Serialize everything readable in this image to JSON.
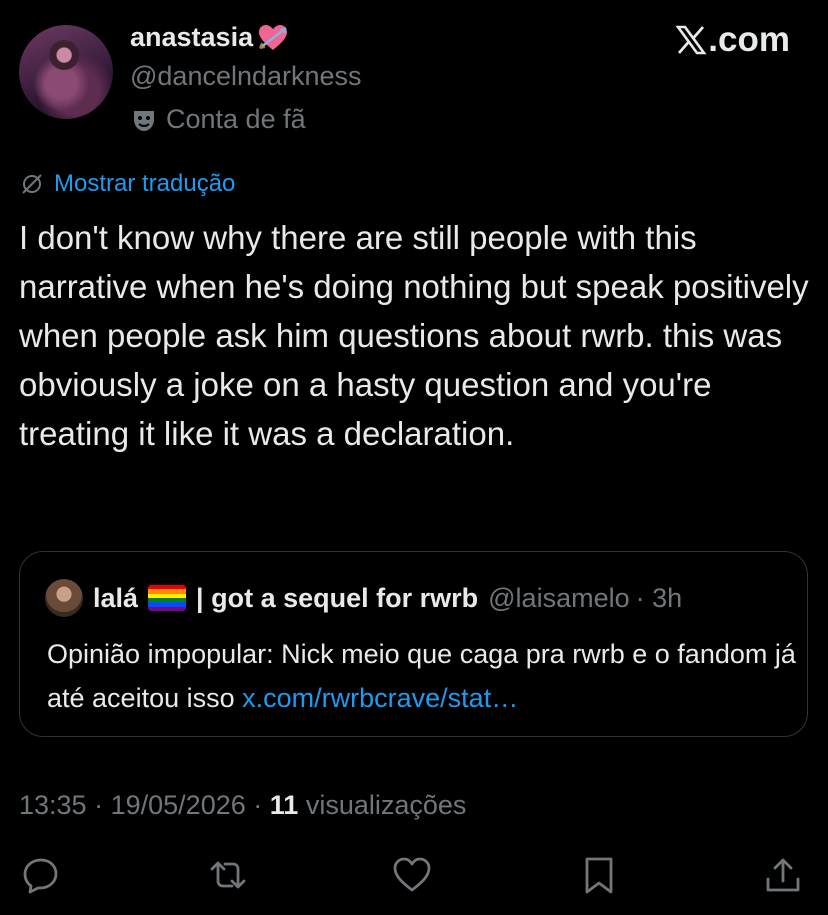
{
  "author": {
    "display_name": "anastasia",
    "name_emoji": "heart-with-arrow-icon",
    "handle": "@dancelndarkness",
    "label": "Conta de fã",
    "label_icon": "theater-mask-icon"
  },
  "brand": {
    "logo_text": ".com",
    "logo_icon": "x-logo-icon"
  },
  "translate": {
    "label": "Mostrar tradução",
    "icon": "globe-slash-icon"
  },
  "tweet": {
    "text": "I don't know why there are still people with this narrative when he's doing nothing but speak positively when people ask him questions about rwrb. this was obviously a joke on a hasty question and you're treating it like it was a declaration."
  },
  "quote": {
    "name": "lalá",
    "name_suffix": "| got a sequel for rwrb",
    "handle": "@laisamelo",
    "time": "· 3h",
    "text": "Opinião impopular: Nick meio que caga pra rwrb e o fandom já até aceitou isso",
    "link": "x.com/rwrbcrave/stat…"
  },
  "meta": {
    "time": "13:35",
    "date": "19/05/2026",
    "views_count": "11",
    "views_label": "visualizações"
  },
  "actions": [
    "reply-icon",
    "repost-icon",
    "like-icon",
    "bookmark-icon",
    "share-icon"
  ],
  "colors": {
    "background": "#000000",
    "text": "#e7e9ea",
    "muted": "#71767b",
    "link": "#1d9bf0",
    "border": "#2f3336"
  }
}
